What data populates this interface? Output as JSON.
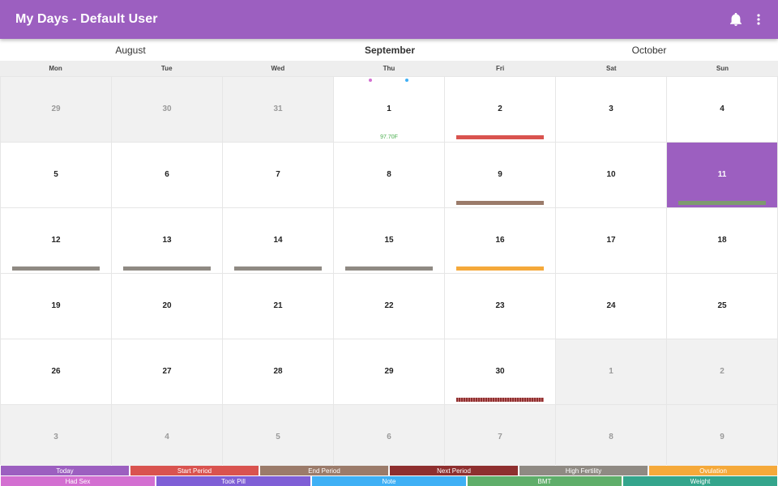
{
  "appbar": {
    "title": "My Days - Default User",
    "bell_icon": "bell-icon",
    "menu_icon": "more-vert-icon"
  },
  "months": {
    "prev": "August",
    "current": "September",
    "next": "October"
  },
  "weekdays": [
    "Mon",
    "Tue",
    "Wed",
    "Thu",
    "Fri",
    "Sat",
    "Sun"
  ],
  "weeks": [
    [
      "29",
      "30",
      "31",
      "1",
      "2",
      "3",
      "4"
    ],
    [
      "5",
      "6",
      "7",
      "8",
      "9",
      "10",
      "11"
    ],
    [
      "12",
      "13",
      "14",
      "15",
      "16",
      "17",
      "18"
    ],
    [
      "19",
      "20",
      "21",
      "22",
      "23",
      "24",
      "25"
    ],
    [
      "26",
      "27",
      "28",
      "29",
      "30",
      "1",
      "2"
    ],
    [
      "3",
      "4",
      "5",
      "6",
      "7",
      "8",
      "9"
    ]
  ],
  "temperature": "97.70F",
  "legend_row1": [
    "Today",
    "Start Period",
    "End Period",
    "Next Period",
    "High Fertility",
    "Ovulation"
  ],
  "legend_row2": [
    "Had Sex",
    "Took Pill",
    "Note",
    "BMT",
    "Weight"
  ],
  "colors": {
    "primary": "#9c5fc0",
    "today": "#9c5fc0",
    "start_period": "#d9534f",
    "end_period": "#9b7b6a",
    "next_period": "#8e2f2f",
    "high_fertility": "#8f8a83",
    "ovulation": "#f5a93a",
    "had_sex": "#d36fd1",
    "took_pill": "#7f5fd6",
    "note": "#3fb0f5",
    "bmt": "#5fae6a",
    "weight": "#34a58c"
  }
}
